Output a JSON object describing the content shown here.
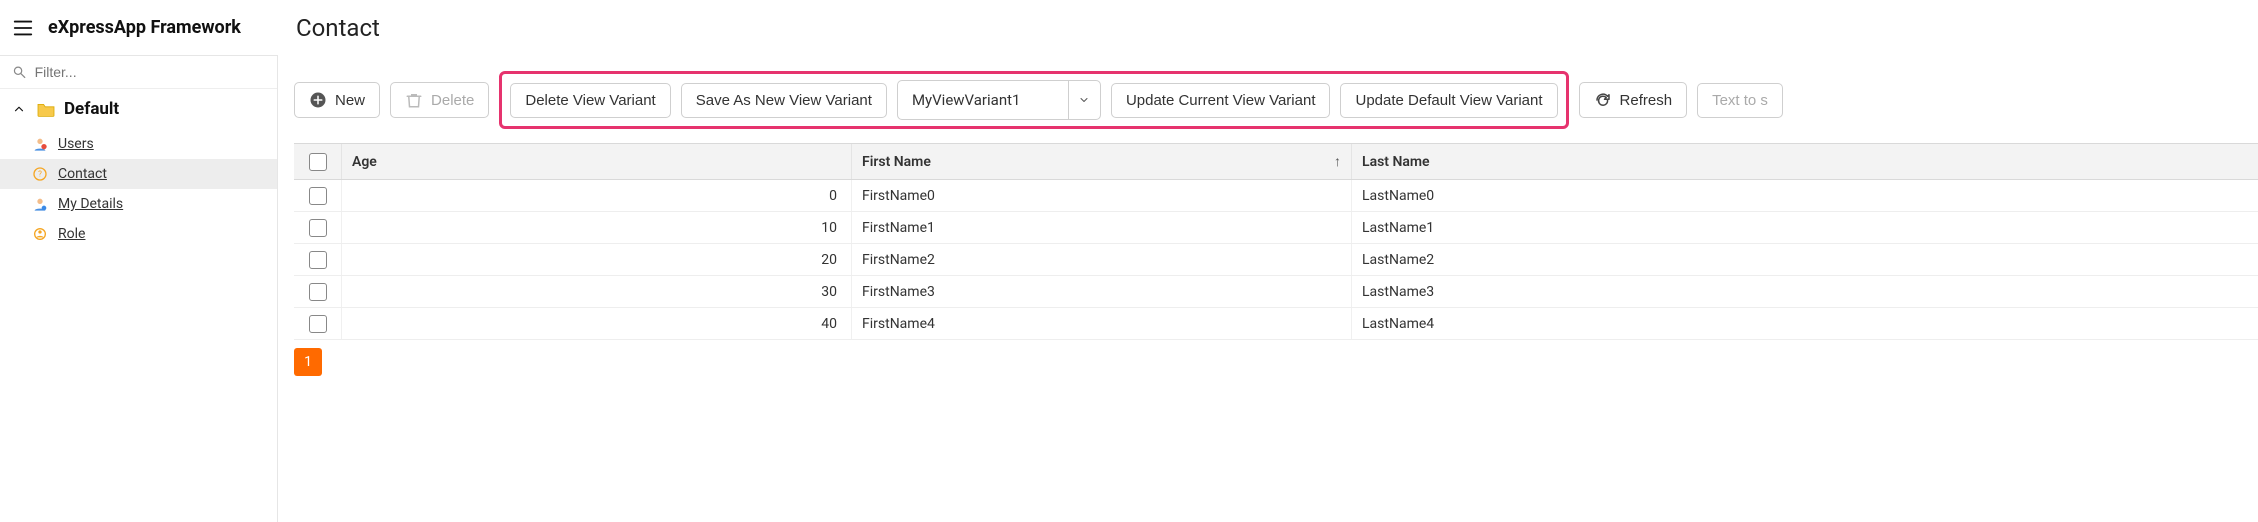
{
  "header": {
    "brand": "eXpressApp Framework",
    "view_title": "Contact"
  },
  "sidebar": {
    "filter_placeholder": "Filter...",
    "group_label": "Default",
    "items": [
      {
        "label": "Users",
        "icon": "user-red"
      },
      {
        "label": "Contact",
        "icon": "contact"
      },
      {
        "label": "My Details",
        "icon": "user-blue"
      },
      {
        "label": "Role",
        "icon": "role"
      }
    ],
    "active_index": 1
  },
  "toolbar": {
    "new_label": "New",
    "delete_label": "Delete",
    "delete_view_variant": "Delete View Variant",
    "save_as_new": "Save As New View Variant",
    "variant_selected": "MyViewVariant1",
    "update_current": "Update Current View Variant",
    "update_default": "Update Default View Variant",
    "refresh_label": "Refresh",
    "search_placeholder": "Text to s"
  },
  "grid": {
    "columns": [
      "Age",
      "First Name",
      "Last Name"
    ],
    "sort_column_index": 1,
    "sort_dir": "asc",
    "rows": [
      {
        "age": 0,
        "first": "FirstName0",
        "last": "LastName0"
      },
      {
        "age": 10,
        "first": "FirstName1",
        "last": "LastName1"
      },
      {
        "age": 20,
        "first": "FirstName2",
        "last": "LastName2"
      },
      {
        "age": 30,
        "first": "FirstName3",
        "last": "LastName3"
      },
      {
        "age": 40,
        "first": "FirstName4",
        "last": "LastName4"
      }
    ]
  },
  "pager": {
    "current": "1"
  }
}
